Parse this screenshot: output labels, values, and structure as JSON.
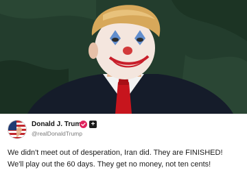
{
  "post": {
    "author": {
      "name": "Donald J. Trump",
      "handle": "@realDonaldTrump"
    },
    "follow_symbol": "+",
    "media": {
      "icon": "photo"
    },
    "text_lines": [
      "We didn't meet out of desperation, Iran did. They are FINISHED!",
      "We'll play out the 60 days. They get no money, not ten cents!"
    ]
  },
  "colors": {
    "verified_badge": "#e0245e",
    "text": "#1a1a1a",
    "handle": "#7a7a7a"
  }
}
